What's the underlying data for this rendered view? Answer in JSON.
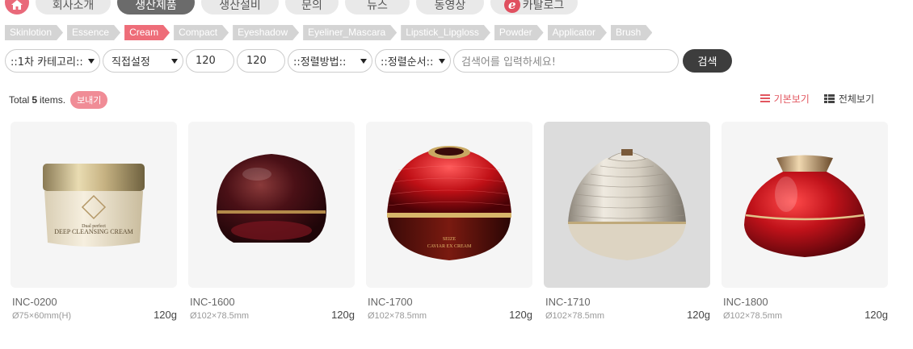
{
  "topnav": {
    "items": [
      {
        "label": "회사소개"
      },
      {
        "label": "생산제품",
        "active": true
      },
      {
        "label": "생산설비"
      },
      {
        "label": "문의"
      },
      {
        "label": "뉴스"
      },
      {
        "label": "동영상"
      },
      {
        "label": "카탈로그",
        "icon": "catalog-e-icon"
      }
    ],
    "home_icon": "home-icon",
    "e_glyph": "e"
  },
  "categories": [
    {
      "label": "Skinlotion"
    },
    {
      "label": "Essence"
    },
    {
      "label": "Cream",
      "active": true
    },
    {
      "label": "Compact"
    },
    {
      "label": "Eyeshadow"
    },
    {
      "label": "Eyeliner_Mascara"
    },
    {
      "label": "Lipstick_Lipgloss"
    },
    {
      "label": "Powder"
    },
    {
      "label": "Applicator"
    },
    {
      "label": "Brush"
    }
  ],
  "filters": {
    "category1": "::1차 카테고리::",
    "size_mode": "직접설정",
    "width_value": "120",
    "height_value": "120",
    "sort_method": "::정렬방법::",
    "sort_order": "::정렬순서::",
    "search_placeholder": "검색어를 입력하세요!",
    "search_button": "검색"
  },
  "summary": {
    "prefix": "Total",
    "count": "5",
    "suffix": "items.",
    "send_button": "보내기"
  },
  "views": {
    "basic": "기본보기",
    "all": "전체보기"
  },
  "products": [
    {
      "code": "INC-0200",
      "size": "Ø75×60mm(H)",
      "weight": "120g",
      "label_line1": "DEEP CLEANSING CREAM",
      "label_line2": "Dual perfect"
    },
    {
      "code": "INC-1600",
      "size": "Ø102×78.5mm",
      "weight": "120g"
    },
    {
      "code": "INC-1700",
      "size": "Ø102×78.5mm",
      "weight": "120g",
      "label_line1": "CAVIAR EX CREAM",
      "label_line2": "SEIZE"
    },
    {
      "code": "INC-1710",
      "size": "Ø102×78.5mm",
      "weight": "120g"
    },
    {
      "code": "INC-1800",
      "size": "Ø102×78.5mm",
      "weight": "120g"
    }
  ],
  "colors": {
    "accent": "#ee6d79",
    "nav_active": "#6b6b6b",
    "search_button": "#3d3d3d"
  }
}
